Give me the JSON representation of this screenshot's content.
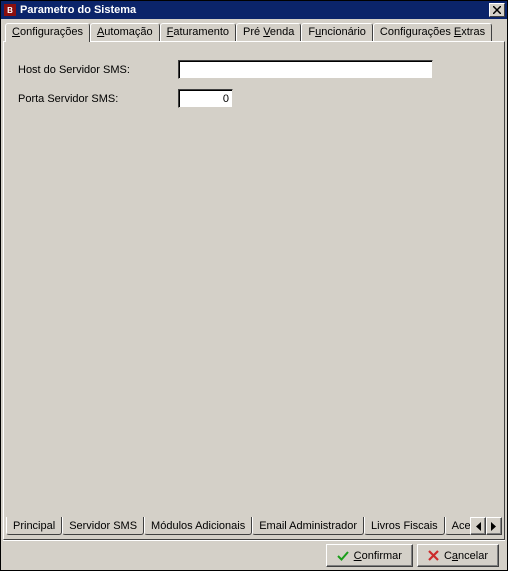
{
  "window": {
    "title": "Parametro do Sistema"
  },
  "top_tabs": {
    "t0": {
      "pre": "",
      "ul": "C",
      "post": "onfigurações"
    },
    "t1": {
      "pre": "",
      "ul": "A",
      "post": "utomação"
    },
    "t2": {
      "pre": "",
      "ul": "F",
      "post": "aturamento"
    },
    "t3": {
      "pre": "Pré ",
      "ul": "V",
      "post": "enda"
    },
    "t4": {
      "pre": "F",
      "ul": "u",
      "post": "ncionário"
    },
    "t5": {
      "pre": "Configurações ",
      "ul": "E",
      "post": "xtras"
    }
  },
  "form": {
    "host_label": "Host do Servidor SMS:",
    "host_value": "",
    "port_label": "Porta Servidor SMS:",
    "port_value": "0"
  },
  "bottom_tabs": {
    "b0": "Principal",
    "b1": "Servidor SMS",
    "b2": "Módulos Adicionais",
    "b3": "Email Administrador",
    "b4": "Livros Fiscais",
    "b5": "Acesso"
  },
  "buttons": {
    "confirm": {
      "pre": "",
      "ul": "C",
      "post": "onfirmar"
    },
    "cancel": {
      "pre": "C",
      "ul": "a",
      "post": "ncelar"
    }
  },
  "colors": {
    "titlebar_bg": "#0b246a",
    "face": "#d4d0c8",
    "check_green": "#1a9e1a",
    "x_red": "#cc2b2b"
  }
}
